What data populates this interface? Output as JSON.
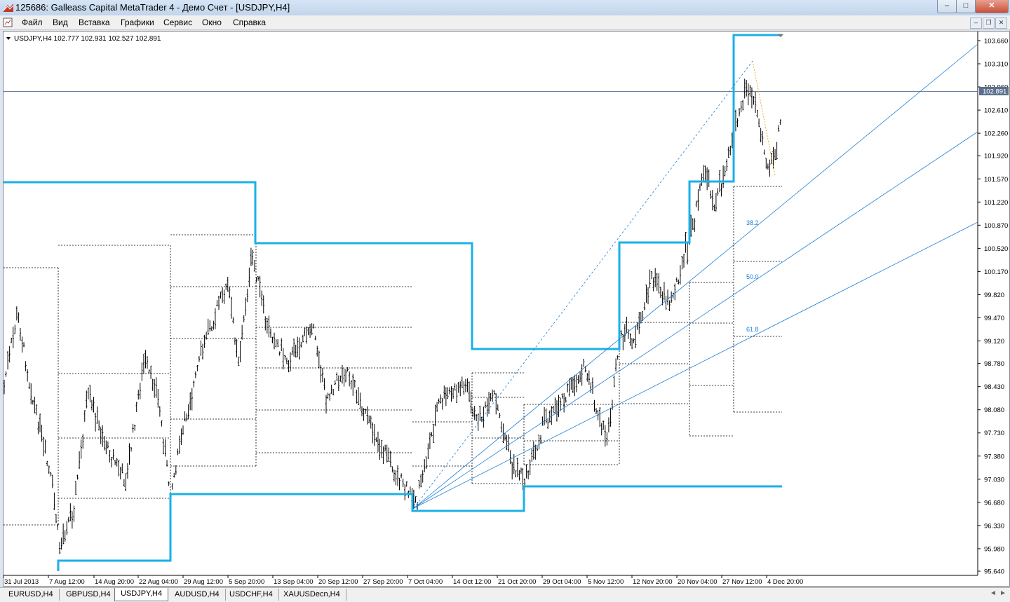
{
  "window": {
    "title": "125686: Galleass Capital MetaTrader 4 - Демо Счет - [USDJPY,H4]",
    "minimize_label": "–",
    "maximize_label": "□",
    "close_label": "✕"
  },
  "menu": {
    "items": [
      "Файл",
      "Вид",
      "Вставка",
      "Графики",
      "Сервис",
      "Окно",
      "Справка"
    ],
    "mdi_minimize": "–",
    "mdi_restore": "❐",
    "mdi_close": "✕"
  },
  "chart": {
    "header": "USDJPY,H4  102.777 102.931 102.527 102.891",
    "current_price_label": "102.891"
  },
  "chart_data": {
    "type": "bar",
    "symbol": "USDJPY",
    "timeframe": "H4",
    "ohlc": {
      "open": 102.777,
      "high": 102.931,
      "low": 102.527,
      "close": 102.891
    },
    "y_ticks": [
      "103.660",
      "103.310",
      "102.960",
      "102.610",
      "102.260",
      "101.920",
      "101.570",
      "101.220",
      "100.870",
      "100.520",
      "100.170",
      "99.820",
      "99.470",
      "99.120",
      "98.780",
      "98.430",
      "98.080",
      "97.730",
      "97.380",
      "97.030",
      "96.680",
      "96.330",
      "95.980",
      "95.640"
    ],
    "x_ticks": [
      "31 Jul 2013",
      "7 Aug 12:00",
      "14 Aug 20:00",
      "22 Aug 04:00",
      "29 Aug 12:00",
      "5 Sep 20:00",
      "13 Sep 04:00",
      "20 Sep 12:00",
      "27 Sep 20:00",
      "7 Oct 04:00",
      "14 Oct 12:00",
      "21 Oct 20:00",
      "29 Oct 04:00",
      "5 Nov 12:00",
      "12 Nov 20:00",
      "20 Nov 04:00",
      "27 Nov 12:00",
      "4 Dec 20:00"
    ],
    "ylim": [
      95.64,
      103.66
    ],
    "fib_levels": [
      "38.2",
      "50.0",
      "61.8"
    ],
    "colors": {
      "indicator": "#1ab0e8",
      "fib_fan": "#1e7fd6",
      "bars": "#000000",
      "current_price_line": "#5a6f8c"
    }
  },
  "tabs": {
    "items": [
      "EURUSD,H4",
      "GBPUSD,H4",
      "USDJPY,H4",
      "AUDUSD,H4",
      "USDCHF,H4",
      "XAUUSDecn,H4"
    ],
    "active_index": 2,
    "nav_left": "◄",
    "nav_right": "►"
  }
}
